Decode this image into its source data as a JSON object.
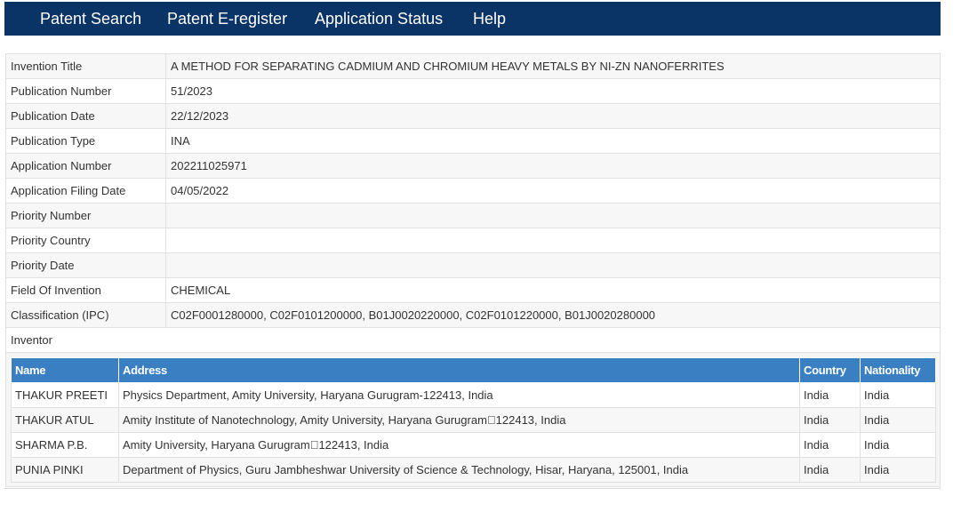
{
  "nav": {
    "items": [
      {
        "label": "Patent Search"
      },
      {
        "label": "Patent E-register"
      },
      {
        "label": "Application Status"
      },
      {
        "label": "Help"
      }
    ]
  },
  "details": {
    "rows": [
      {
        "label": "Invention Title",
        "value": "A METHOD FOR SEPARATING CADMIUM AND CHROMIUM HEAVY METALS BY NI-ZN NANOFERRITES"
      },
      {
        "label": "Publication Number",
        "value": "51/2023"
      },
      {
        "label": "Publication Date",
        "value": "22/12/2023"
      },
      {
        "label": "Publication Type",
        "value": "INA"
      },
      {
        "label": "Application Number",
        "value": "202211025971"
      },
      {
        "label": "Application Filing Date",
        "value": "04/05/2022"
      },
      {
        "label": "Priority Number",
        "value": ""
      },
      {
        "label": "Priority Country",
        "value": ""
      },
      {
        "label": "Priority Date",
        "value": ""
      },
      {
        "label": "Field Of Invention",
        "value": "CHEMICAL"
      },
      {
        "label": "Classification (IPC)",
        "value": "C02F0001280000, C02F0101200000, B01J0020220000, C02F0101220000, B01J0020280000"
      },
      {
        "label": "Inventor",
        "value": ""
      }
    ]
  },
  "inventors": {
    "headers": {
      "name": "Name",
      "address": "Address",
      "country": "Country",
      "nationality": "Nationality"
    },
    "rows": [
      {
        "name": "THAKUR PREETI",
        "address": "Physics Department, Amity University, Haryana Gurugram-122413, India",
        "country": "India",
        "nationality": "India"
      },
      {
        "name": "THAKUR ATUL",
        "address": "Amity Institute of Nanotechnology, Amity University, Haryana Gurugram\u0000122413, India",
        "country": "India",
        "nationality": "India"
      },
      {
        "name": "SHARMA P.B.",
        "address": "Amity University, Haryana Gurugram\u0000122413, India",
        "country": "India",
        "nationality": "India"
      },
      {
        "name": "PUNIA PINKI",
        "address": "Department of Physics, Guru Jambheshwar University of Science & Technology, Hisar, Haryana, 125001, India",
        "country": "India",
        "nationality": "India"
      }
    ]
  },
  "colors": {
    "navbar": "#0b3466",
    "table_header": "#3a7fc1"
  }
}
